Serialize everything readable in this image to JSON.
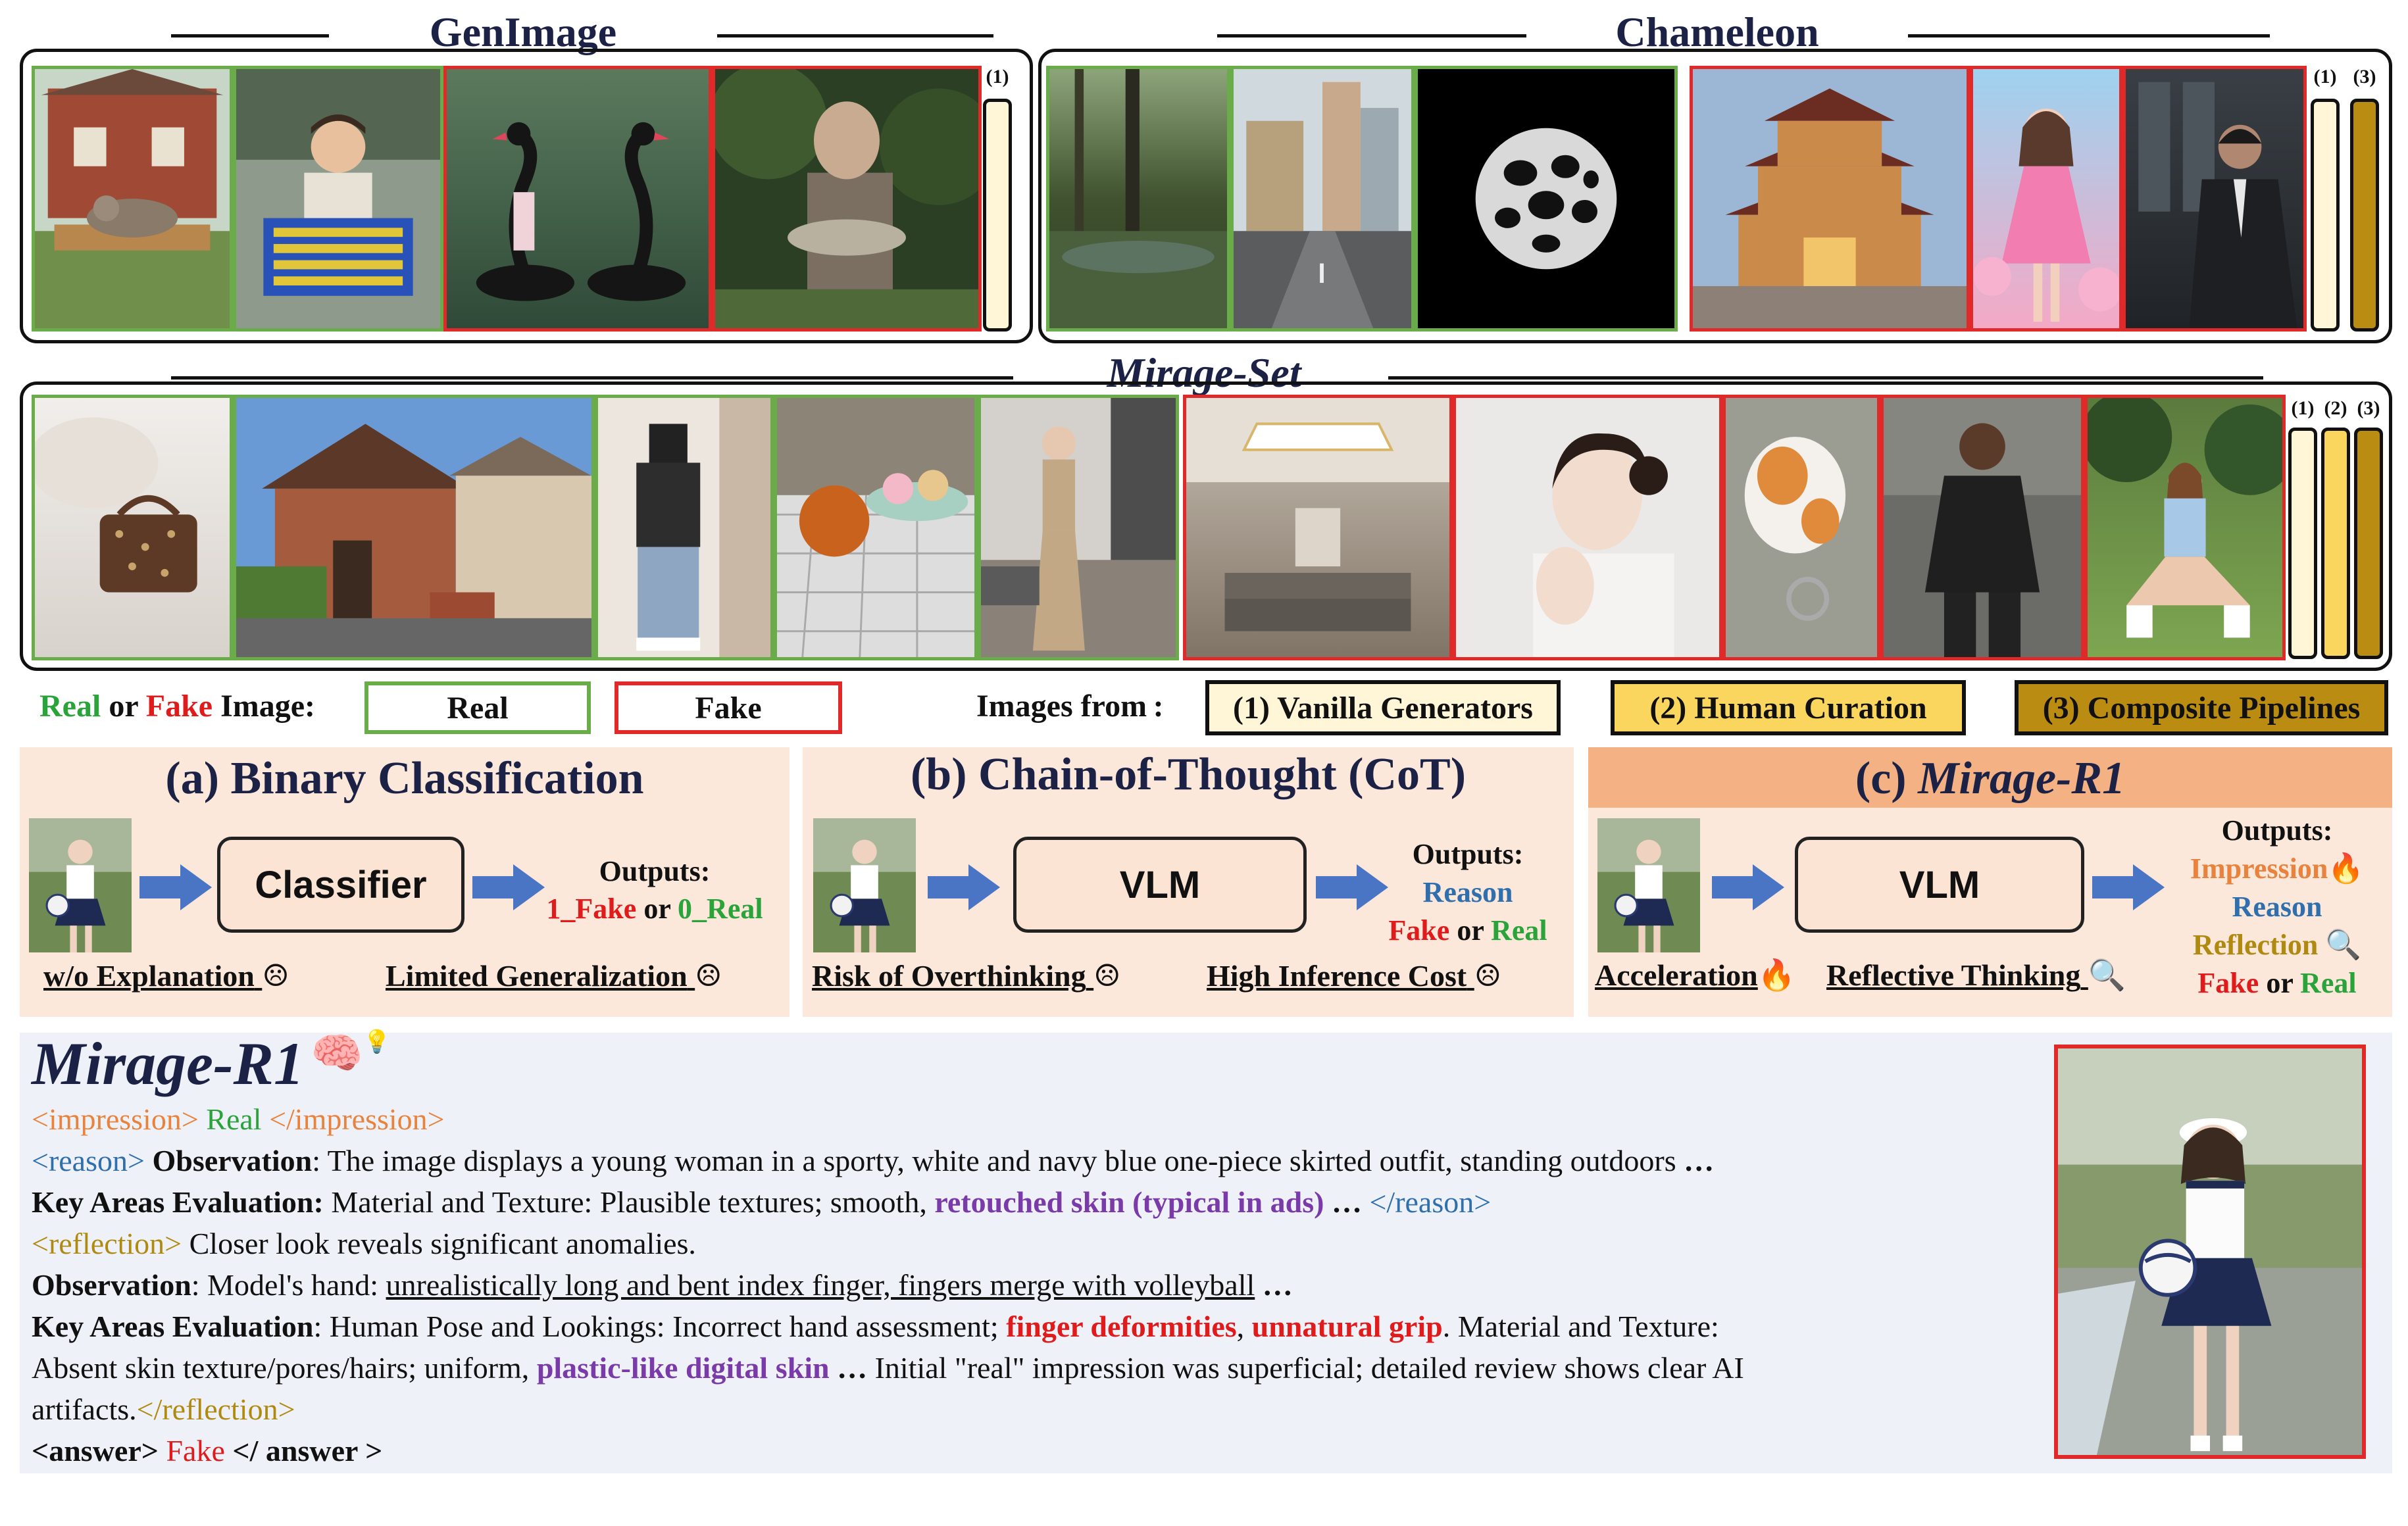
{
  "sections": {
    "genimage": {
      "title": "GenImage",
      "bar_labels": [
        "(1)"
      ]
    },
    "chameleon": {
      "title": "Chameleon",
      "bar_labels": [
        "(1)",
        "(3)"
      ]
    },
    "mirage_set": {
      "title": "Mirage-Set",
      "bar_labels": [
        "(1)",
        "(2)",
        "(3)"
      ]
    }
  },
  "legend": {
    "real": "Real",
    "or": "or",
    "fake": "Fake",
    "image_suffix": "Image:",
    "real_box": "Real",
    "fake_box": "Fake",
    "images_from": "Images from :",
    "src1": "(1) Vanilla Generators",
    "src2": "(2) Human Curation",
    "src3": "(3) Composite Pipelines"
  },
  "colors": {
    "real": "#6aab4a",
    "fake": "#e02a2a",
    "src1": "#fff6d8",
    "src2": "#fbd65f",
    "src3": "#bb8c12",
    "panel": "#fbe8db",
    "panel_c_header": "#f4b183",
    "example_bg": "#eef2f8"
  },
  "panels": {
    "a": {
      "title": "(a) Binary Classification",
      "model": "Classifier",
      "outputs_label": "Outputs:",
      "out_fake": "1_Fake",
      "out_or": "or",
      "out_real": "0_Real",
      "note_left": "w/o Explanation",
      "note_right": "Limited Generalization"
    },
    "b": {
      "title": "(b) Chain-of-Thought (CoT)",
      "model": "VLM",
      "outputs_label": "Outputs:",
      "out_reason": "Reason",
      "out_fake": "Fake",
      "out_or": "or",
      "out_real": "Real",
      "note_left": "Risk of Overthinking",
      "note_right": "High Inference Cost"
    },
    "c": {
      "title_prefix": "(c) ",
      "title_name": "Mirage-R1",
      "model": "VLM",
      "outputs_label": "Outputs:",
      "out_impression": "Impression",
      "out_reason": "Reason",
      "out_reflection": "Reflection",
      "out_fake": "Fake",
      "out_or": "or",
      "out_real": "Real",
      "note_left": "Acceleration",
      "note_right": "Reflective Thinking"
    }
  },
  "example": {
    "title": "Mirage-R1",
    "l1_open": "<impression>",
    "l1_val": " Real ",
    "l1_close": "</impression>",
    "l2_tag": "<reason>",
    "l2_key": " Observation",
    "l2_text": ": The image displays a young woman in a sporty, white and navy blue one-piece skirted outfit, standing outdoors ",
    "l2_ell": "…",
    "l3_key": "Key Areas Evaluation:",
    "l3_text": " Material and Texture: Plausible textures; smooth, ",
    "l3_hl": "retouched skin (typical in ads)",
    "l3_ell": " … ",
    "l3_close": "</reason>",
    "l4_tag": "<reflection>",
    "l4_text": " Closer look reveals significant anomalies.",
    "l5_key": "Observation",
    "l5_text": ": Model's hand: ",
    "l5_ul": "unrealistically long and bent index finger, fingers merge with volleyball",
    "l5_ell": " …",
    "l6_key": "Key Areas Evaluation",
    "l6_text": ": Human Pose and Lookings: Incorrect hand assessment; ",
    "l6_hl1": "finger deformities",
    "l6_comma": ", ",
    "l6_hl2": "unnatural grip",
    "l6_text2": ". Material and Texture:",
    "l7_text": "Absent skin texture/pores/hairs; uniform, ",
    "l7_hl": "plastic-like digital skin",
    "l7_ell": " … ",
    "l7_text2": "Initial \"real\" impression was superficial; detailed review shows clear AI",
    "l8_text": "artifacts.",
    "l8_close": "</reflection>",
    "l9_open": "<answer>",
    "l9_val": " Fake ",
    "l9_close": "</ answer >"
  }
}
